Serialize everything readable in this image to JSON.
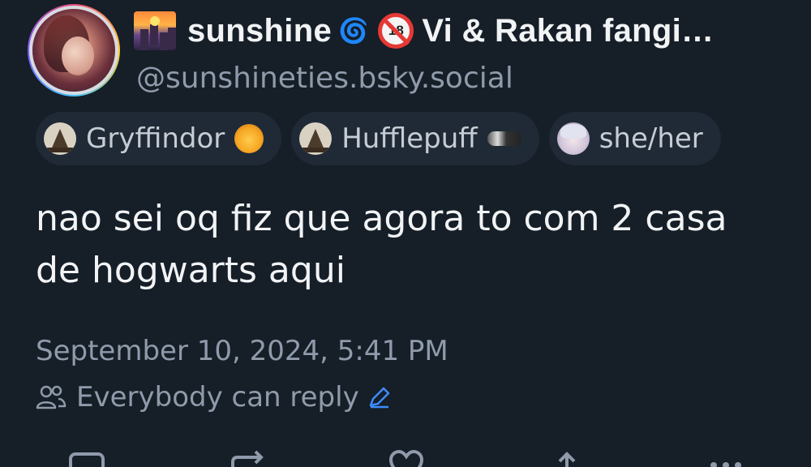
{
  "author": {
    "display_name": "sunshine",
    "display_name_suffix": "Vi & Rakan fangi…",
    "handle": "@sunshineties.bsky.social"
  },
  "labels": [
    {
      "text": "Gryffindor",
      "icon": "sorting-hat-icon",
      "emoji": "lion-face"
    },
    {
      "text": "Hufflepuff",
      "icon": "sorting-hat-icon",
      "emoji": "badger"
    },
    {
      "text": "she/her",
      "icon": "anime-avatar-icon"
    }
  ],
  "post": {
    "text": "nao sei oq fiz que agora to com 2 casa de hogwarts aqui",
    "timestamp": "September 10, 2024, 5:41 PM",
    "reply_setting": "Everybody can reply"
  },
  "actions": [
    "reply-icon",
    "repost-icon",
    "like-icon",
    "share-icon",
    "more-icon"
  ],
  "colors": {
    "background": "#161e27",
    "label_bg": "#202a36",
    "muted_text": "#8f9bab",
    "accent_blue": "#3d8bfd"
  }
}
